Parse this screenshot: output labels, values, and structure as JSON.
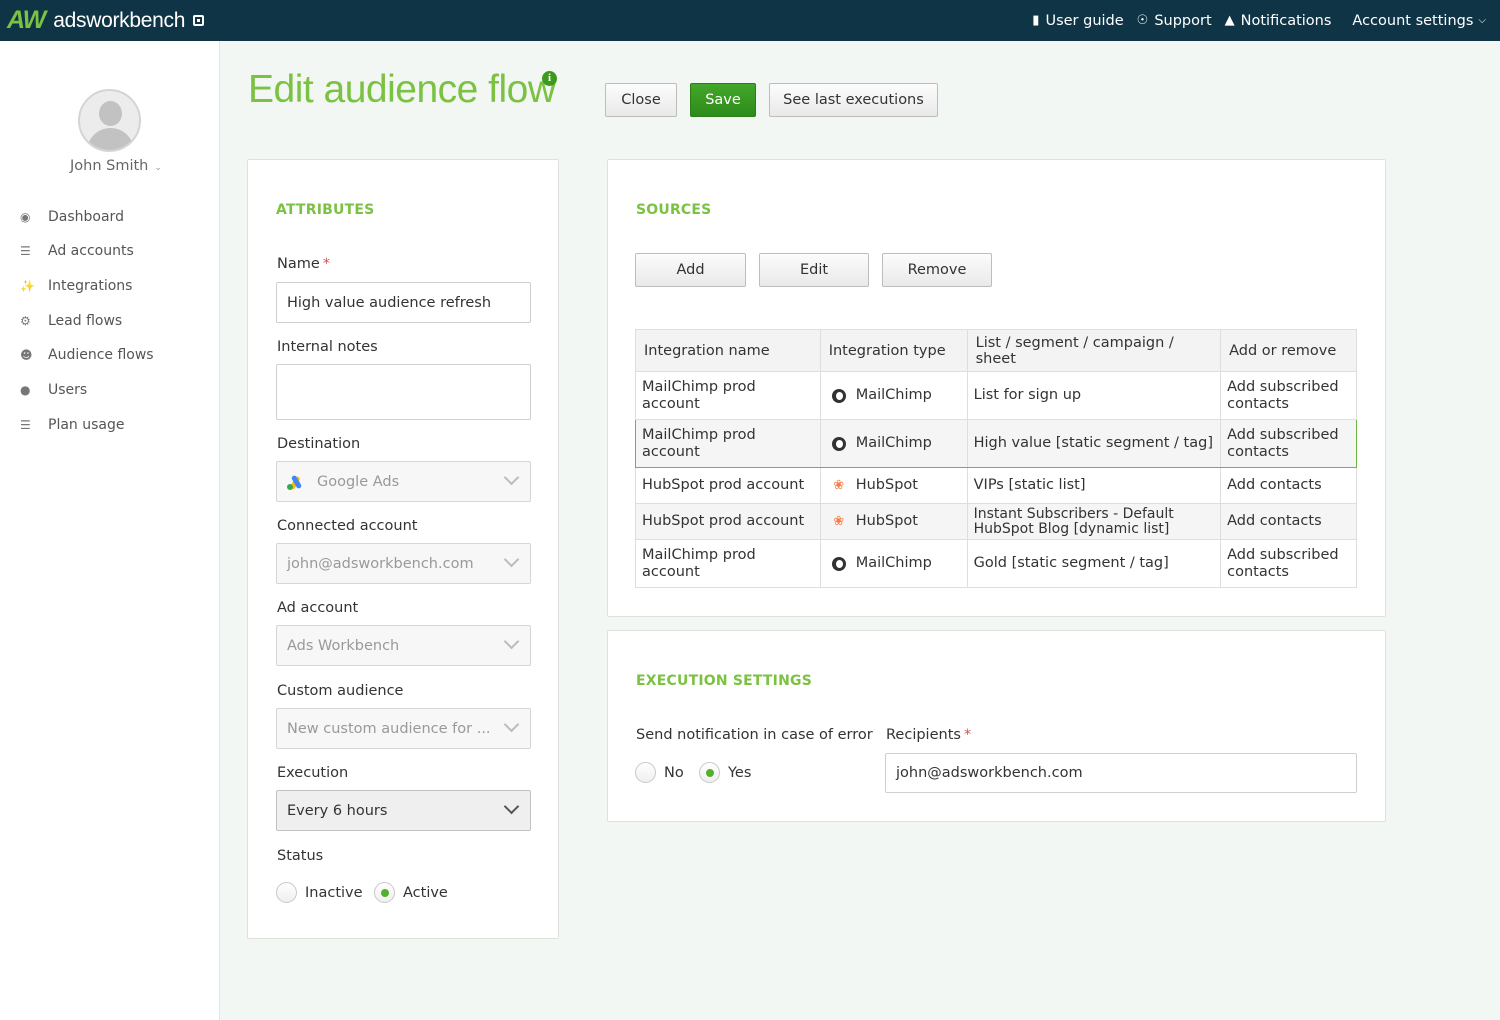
{
  "app": {
    "logo_mark": "AW",
    "logo_text": "adsworkbench"
  },
  "topnav": {
    "user_guide": "User guide",
    "support": "Support",
    "notifications": "Notifications",
    "account_settings": "Account settings"
  },
  "sidebar": {
    "user_name": "John Smith",
    "items": [
      {
        "label": "Dashboard",
        "icon": "dashboard-icon"
      },
      {
        "label": "Ad accounts",
        "icon": "database-icon"
      },
      {
        "label": "Integrations",
        "icon": "plug-icon"
      },
      {
        "label": "Lead flows",
        "icon": "gears-icon"
      },
      {
        "label": "Audience flows",
        "icon": "users-group-icon"
      },
      {
        "label": "Users",
        "icon": "user-icon"
      },
      {
        "label": "Plan usage",
        "icon": "list-icon"
      }
    ]
  },
  "page": {
    "title": "Edit audience flow",
    "info": "i"
  },
  "actions": {
    "close": "Close",
    "save": "Save",
    "see_last": "See last executions"
  },
  "attributes": {
    "title": "ATTRIBUTES",
    "name_label": "Name",
    "required": "*",
    "name_value": "High value audience refresh",
    "notes_label": "Internal notes",
    "notes_value": "",
    "destination_label": "Destination",
    "destination_value": "Google Ads",
    "connected_label": "Connected account",
    "connected_value": "john@adsworkbench.com",
    "adaccount_label": "Ad account",
    "adaccount_value": "Ads Workbench",
    "custom_label": "Custom audience",
    "custom_value": "New custom audience for ...",
    "execution_label": "Execution",
    "execution_value": "Every 6 hours",
    "status_label": "Status",
    "status_inactive": "Inactive",
    "status_active": "Active",
    "status_selected": "Active"
  },
  "sources": {
    "title": "SOURCES",
    "add": "Add",
    "edit": "Edit",
    "remove": "Remove",
    "columns": [
      "Integration name",
      "Integration type",
      "List / segment / campaign / sheet",
      "Add or remove"
    ],
    "rows": [
      {
        "name": "MailChimp prod account",
        "type": "MailChimp",
        "icon": "mailchimp-icon",
        "list": "List for sign up",
        "action": "Add subscribed contacts"
      },
      {
        "name": "MailChimp prod account",
        "type": "MailChimp",
        "icon": "mailchimp-icon",
        "list": "High value [static segment / tag]",
        "action": "Add subscribed contacts"
      },
      {
        "name": "HubSpot prod account",
        "type": "HubSpot",
        "icon": "hubspot-icon",
        "list": "VIPs [static list]",
        "action": "Add contacts"
      },
      {
        "name": "HubSpot prod account",
        "type": "HubSpot",
        "icon": "hubspot-icon",
        "list": "Instant Subscribers - Default HubSpot Blog [dynamic list]",
        "action": "Add contacts"
      },
      {
        "name": "MailChimp prod account",
        "type": "MailChimp",
        "icon": "mailchimp-icon",
        "list": "Gold [static segment / tag]",
        "action": "Add subscribed contacts"
      }
    ]
  },
  "execution": {
    "title": "EXECUTION SETTINGS",
    "notify_label": "Send notification in case of error",
    "no": "No",
    "yes": "Yes",
    "notify_selected": "Yes",
    "recipients_label": "Recipients",
    "recipients_value": "john@adsworkbench.com"
  },
  "colors": {
    "topbar": "#0e3446",
    "accent": "#7bc142",
    "save_button": "#3c9a1c"
  }
}
